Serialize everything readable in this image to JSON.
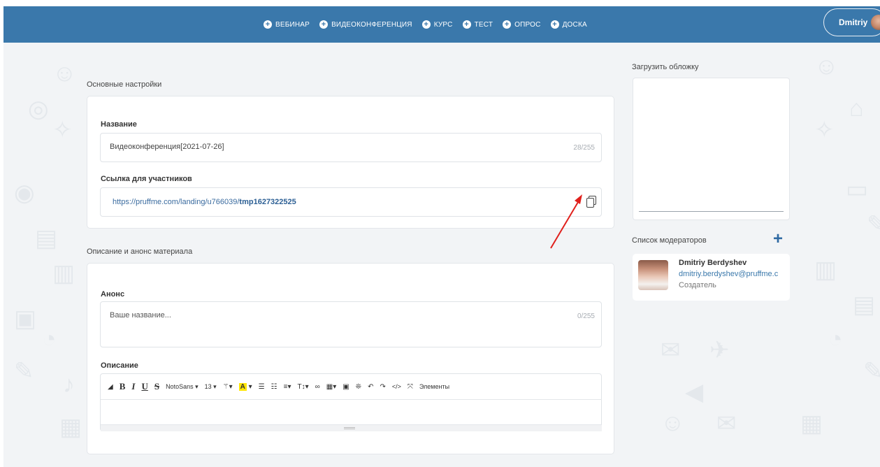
{
  "nav": {
    "items": [
      {
        "label": "ВЕБИНАР"
      },
      {
        "label": "ВИДЕОКОНФЕРЕНЦИЯ"
      },
      {
        "label": "КУРС"
      },
      {
        "label": "ТЕСТ"
      },
      {
        "label": "ОПРОС"
      },
      {
        "label": "ДОСКА"
      }
    ],
    "user_name": "Dmitriy"
  },
  "main_settings": {
    "section_title": "Основные настройки",
    "name_label": "Название",
    "name_value": "Видеоконференция[2021-07-26]",
    "name_counter": "28/255",
    "link_label": "Ссылка для участников",
    "link_prefix": "https://pruffme.com/landing/u766039/",
    "link_slug": "tmp1627322525"
  },
  "description": {
    "section_title": "Описание и анонс материала",
    "announce_label": "Анонс",
    "announce_placeholder": "Ваше название...",
    "announce_counter": "0/255",
    "description_label": "Описание",
    "toolbar": {
      "font_family": "NotoSans ▾",
      "font_size": "13 ▾",
      "elements_label": "Элементы"
    }
  },
  "sidebar": {
    "cover_label": "Загрузить обложку",
    "moderators_label": "Список модераторов",
    "moderator": {
      "name": "Dmitriy Berdyshev",
      "email": "dmitriy.berdyshev@pruffme.c",
      "role": "Создатель"
    }
  },
  "colors": {
    "header_bg": "#3a78ab",
    "page_bg": "#f2f4f6",
    "link": "#3a6b9f",
    "arrow": "#e0201c"
  }
}
